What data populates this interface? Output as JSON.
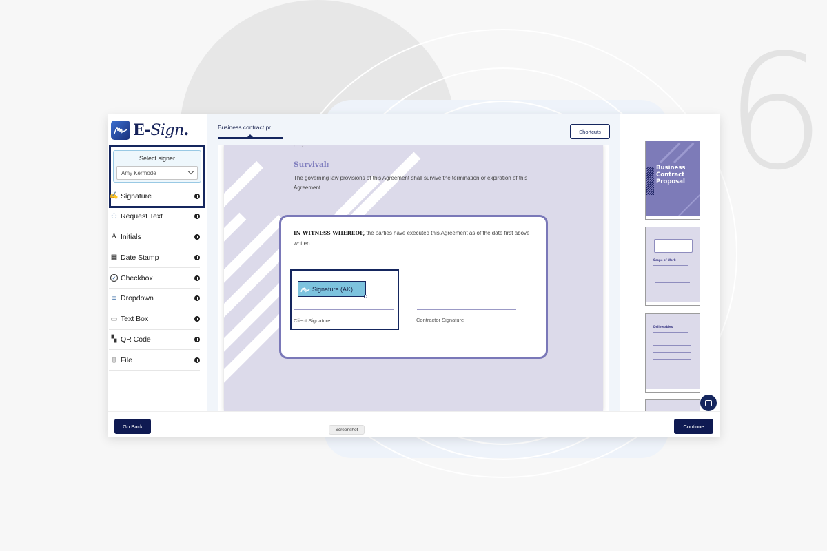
{
  "app": {
    "logo_text_prefix": "E-",
    "logo_text_suffix": "Sign",
    "logo_dot": "."
  },
  "sidebar": {
    "signer_label": "Select signer",
    "signer_value": "Amy Kermode",
    "tools": [
      {
        "label": "Signature",
        "icon": "signature-icon",
        "glyph": "✍"
      },
      {
        "label": "Request Text",
        "icon": "request-text-icon",
        "glyph": "⚇"
      },
      {
        "label": "Initials",
        "icon": "initials-icon",
        "glyph": "A"
      },
      {
        "label": "Date Stamp",
        "icon": "calendar-icon",
        "glyph": "▦"
      },
      {
        "label": "Checkbox",
        "icon": "check-circle-icon",
        "glyph": "✓"
      },
      {
        "label": "Dropdown",
        "icon": "dropdown-icon",
        "glyph": "≡"
      },
      {
        "label": "Text Box",
        "icon": "text-box-icon",
        "glyph": "▭"
      },
      {
        "label": "QR Code",
        "icon": "qr-code-icon",
        "glyph": "▚"
      },
      {
        "label": "File",
        "icon": "file-icon",
        "glyph": "▯"
      }
    ]
  },
  "center": {
    "tab_label": "Business contract pr...",
    "shortcuts_label": "Shortcuts",
    "document": {
      "clipped_text": "party.",
      "heading": "Survival:",
      "paragraph": "The governing law provisions of this Agreement shall survive the termination or expiration of this Agreement.",
      "witness_bold": "IN WITNESS WHEREOF,",
      "witness_rest": " the parties have executed this Agreement as of the date first above written.",
      "signature_field_label": "Signature (AK)",
      "client_caption": "Client Signature",
      "contractor_caption": "Contractor Signature"
    }
  },
  "thumbnails": {
    "page1_title": "Business Contract Proposal",
    "page2_heading": "Scope of Work",
    "page3_heading": "Deliverables"
  },
  "footer": {
    "go_back_label": "Go Back",
    "continue_label": "Continue",
    "tooltip": "Screenshot"
  },
  "colors": {
    "brand_dark": "#0f1a52",
    "accent_purple": "#7f7dbe",
    "signature_field": "#7dc3de",
    "page_bg": "#dcdaea"
  }
}
